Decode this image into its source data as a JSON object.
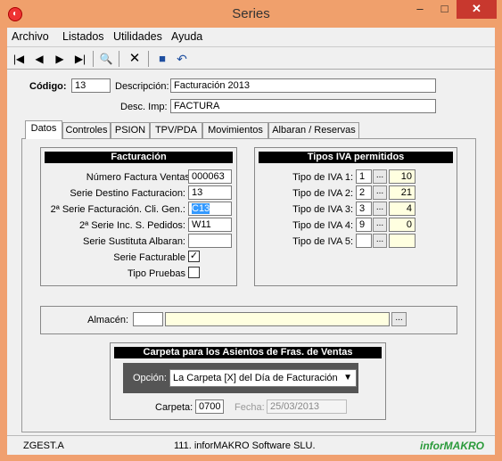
{
  "window": {
    "title": "Series"
  },
  "menu": [
    "Archivo",
    "Listados",
    "Utilidades",
    "Ayuda"
  ],
  "header": {
    "codigo_label": "Código:",
    "codigo_value": "13",
    "descripcion_label": "Descripción:",
    "descripcion_value": "Facturación 2013",
    "desc_imp_label": "Desc. Imp:",
    "desc_imp_value": "FACTURA"
  },
  "tabs": [
    "Datos",
    "Controles",
    "PSION",
    "TPV/PDA",
    "Movimientos",
    "Albaran / Reservas"
  ],
  "facturacion": {
    "title": "Facturación",
    "rows": [
      {
        "label": "Número Factura Ventas:",
        "value": "000063"
      },
      {
        "label": "Serie Destino Facturacion:",
        "value": "13"
      },
      {
        "label": "2ª Serie Facturación. Cli. Gen.:",
        "value": "C13"
      },
      {
        "label": "2ª Serie Inc. S. Pedidos:",
        "value": "W11"
      },
      {
        "label": "Serie Sustituta Albaran:",
        "value": ""
      }
    ],
    "serie_facturable_label": "Serie Facturable",
    "serie_facturable_checked": true,
    "tipo_pruebas_label": "Tipo Pruebas",
    "tipo_pruebas_checked": false
  },
  "iva": {
    "title": "Tipos IVA permitidos",
    "rows": [
      {
        "label": "Tipo de IVA 1:",
        "code": "1",
        "pct": "10"
      },
      {
        "label": "Tipo de IVA 2:",
        "code": "2",
        "pct": "21"
      },
      {
        "label": "Tipo de IVA 3:",
        "code": "3",
        "pct": "4"
      },
      {
        "label": "Tipo de IVA 4:",
        "code": "9",
        "pct": "0"
      },
      {
        "label": "Tipo de IVA 5:",
        "code": "",
        "pct": ""
      }
    ],
    "browse_label": "..."
  },
  "almacen": {
    "label": "Almacén:",
    "code": "",
    "name": "",
    "browse_label": "..."
  },
  "carpeta": {
    "title": "Carpeta para los Asientos de Fras. de Ventas",
    "opcion_label": "Opción:",
    "opcion_value": "La Carpeta [X] del Día de Facturación",
    "carpeta_label": "Carpeta:",
    "carpeta_value": "0700",
    "fecha_label": "Fecha:",
    "fecha_value": "25/03/2013"
  },
  "status": {
    "left": "ZGEST.A",
    "center": "111. inforMAKRO Software SLU.",
    "logo": "inforMAKRO"
  }
}
